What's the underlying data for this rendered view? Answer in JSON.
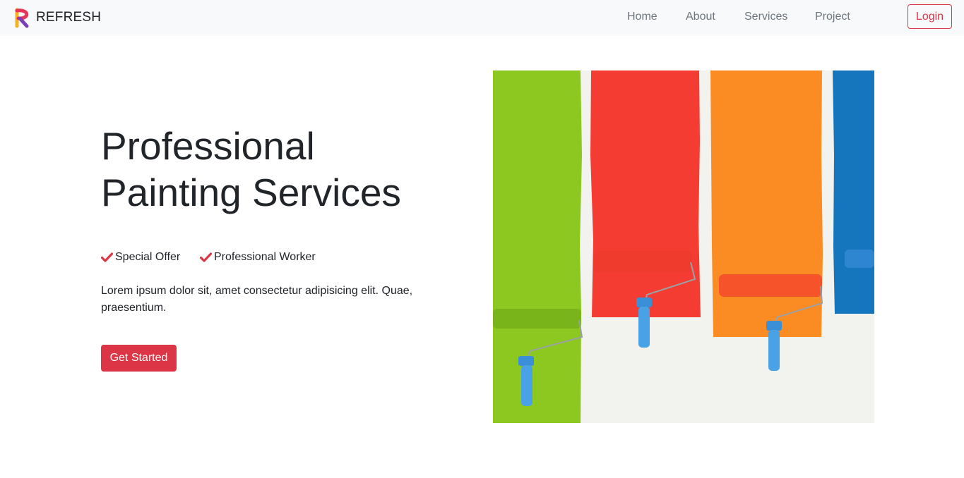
{
  "brand": {
    "name": "REFRESH",
    "logo_icon": "r-logo-icon"
  },
  "nav": {
    "links": [
      "Home",
      "About",
      "Services",
      "Project"
    ],
    "login_label": "Login"
  },
  "hero": {
    "title_line1": "Professional",
    "title_line2": "Painting Services",
    "features": [
      "Special Offer",
      "Professional Worker"
    ],
    "description": "Lorem ipsum dolor sit, amet consectetur adipisicing elit. Quae, praesentium.",
    "cta_label": "Get Started",
    "image_subject": "paint-rollers-color-stripes-image"
  },
  "colors": {
    "accent": "#dc3545",
    "navbar_bg": "#f8f9fa",
    "nav_text": "#6c757d",
    "heading": "#212529",
    "stripe_green": "#8cc820",
    "stripe_red": "#f43c32",
    "stripe_orange": "#fb8c24",
    "stripe_blue": "#1576bd",
    "roller_blue": "#4aa2e6"
  }
}
